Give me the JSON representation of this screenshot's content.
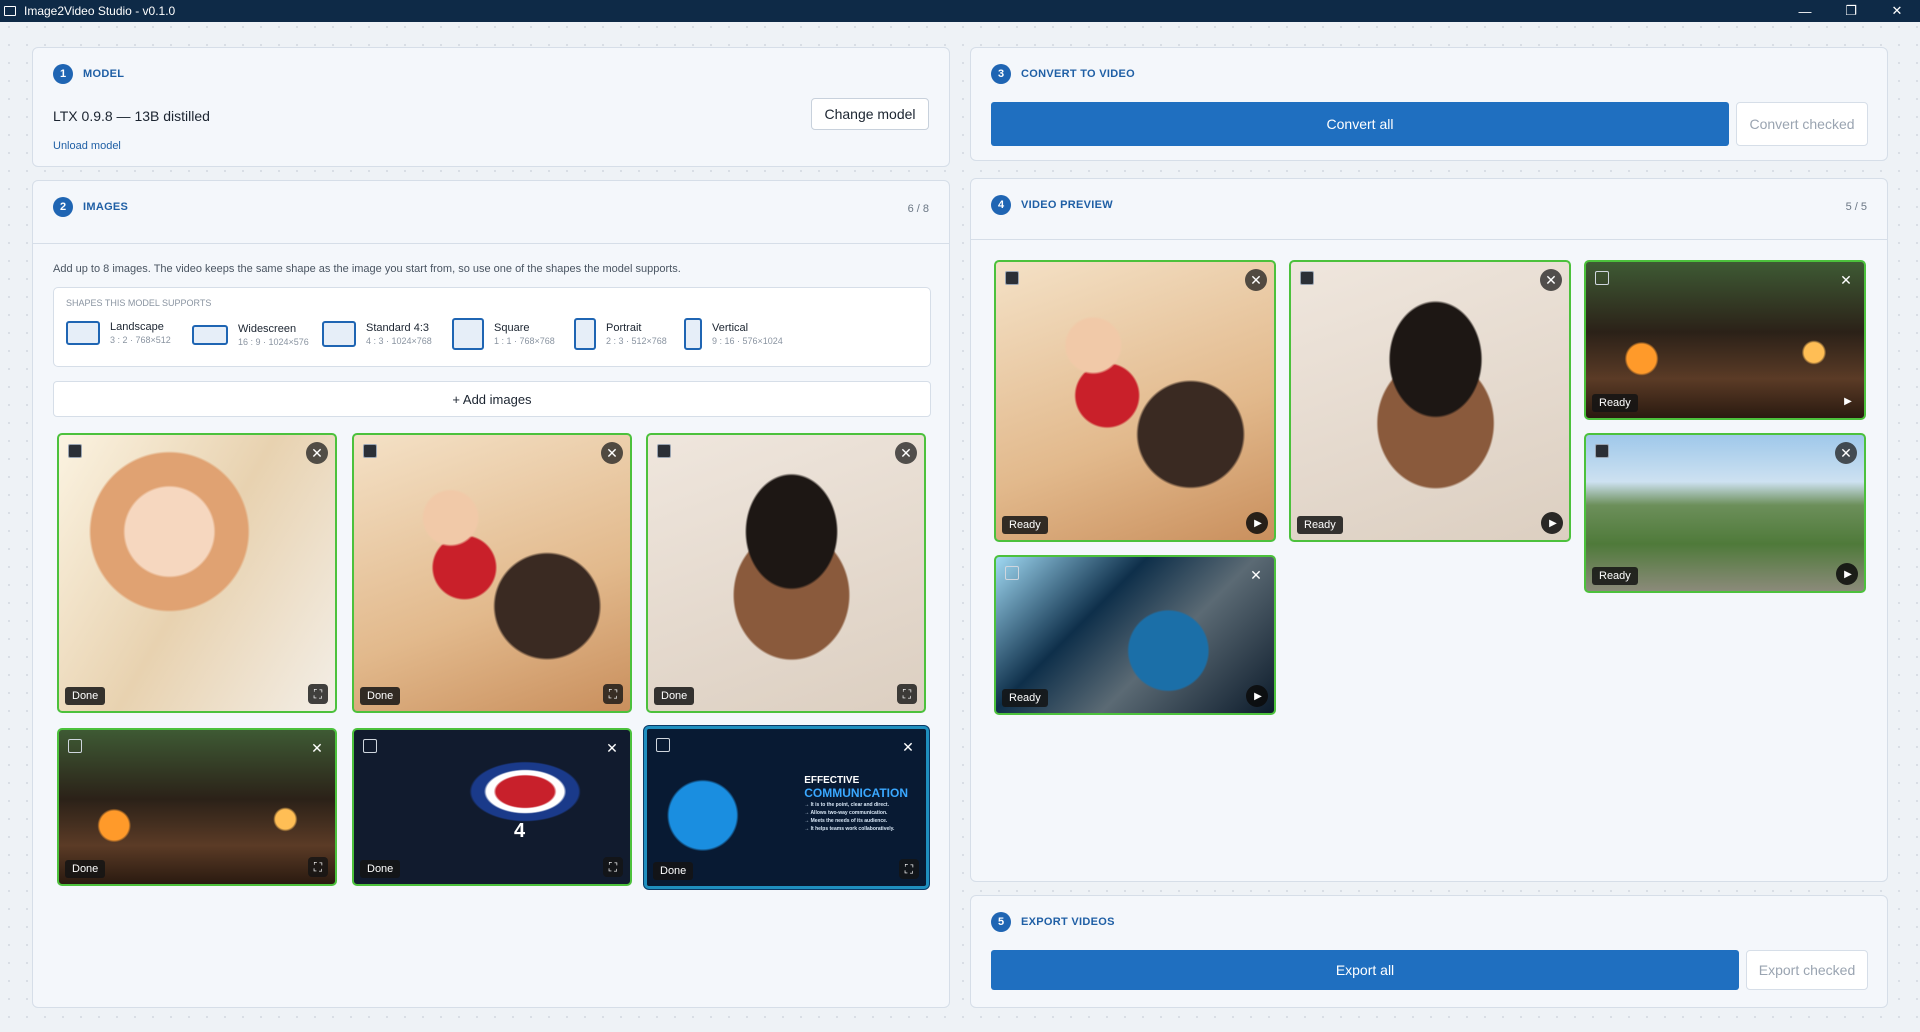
{
  "window": {
    "title": "Image2Video Studio - v0.1.0",
    "controls": [
      "—",
      "❐",
      "✕"
    ]
  },
  "model": {
    "step": "1",
    "title": "MODEL",
    "name": "LTX 0.9.8 — 13B distilled",
    "change_label": "Change model",
    "unload_label": "Unload model"
  },
  "images": {
    "step": "2",
    "title": "IMAGES",
    "count": "6 / 8",
    "description": "Add up to 8 images. The video keeps the same shape as the image you start from, so use one of the shapes the model supports.",
    "shapes_heading": "SHAPES THIS MODEL SUPPORTS",
    "shapes": [
      {
        "name": "Landscape",
        "spec": "3 : 2 · 768×512"
      },
      {
        "name": "Widescreen",
        "spec": "16 : 9 · 1024×576"
      },
      {
        "name": "Standard 4:3",
        "spec": "4 : 3 · 1024×768"
      },
      {
        "name": "Square",
        "spec": "1 : 1 · 768×768"
      },
      {
        "name": "Portrait",
        "spec": "2 : 3 · 512×768"
      },
      {
        "name": "Vertical",
        "spec": "9 : 16 · 576×1024"
      }
    ],
    "add_label": "+ Add images",
    "tiles": [
      {
        "status": "Done",
        "image": "laughing-woman"
      },
      {
        "status": "Done",
        "image": "father-and-baby"
      },
      {
        "status": "Done",
        "image": "smiling-man"
      },
      {
        "status": "Done",
        "image": "living-room-fireplace"
      },
      {
        "status": "Done",
        "image": "fourth-of-july-flag"
      },
      {
        "status": "Done",
        "image": "effective-communication"
      }
    ],
    "july_text": "4",
    "comm_title_1": "EFFECTIVE",
    "comm_title_2": "COMMUNICATION",
    "comm_lines": [
      "→ It is to the point, clear and direct.",
      "→ Allows two-way communication.",
      "→ Meets the needs of its audience.",
      "→ It helps teams work collaboratively."
    ]
  },
  "convert": {
    "step": "3",
    "title": "CONVERT TO VIDEO",
    "convert_all": "Convert all",
    "convert_checked": "Convert checked"
  },
  "preview": {
    "step": "4",
    "title": "VIDEO PREVIEW",
    "count": "5 / 5",
    "tiles": [
      {
        "status": "Ready",
        "image": "father-and-baby"
      },
      {
        "status": "Ready",
        "image": "smiling-man"
      },
      {
        "status": "Ready",
        "image": "living-room-fireplace"
      },
      {
        "status": "Ready",
        "image": "aerial-town"
      },
      {
        "status": "Ready",
        "image": "blue-crystal"
      }
    ]
  },
  "export": {
    "step": "5",
    "title": "EXPORT VIDEOS",
    "export_all": "Export all",
    "export_checked": "Export checked"
  },
  "icons": {
    "close": "✕",
    "expand": "⛶",
    "play": "▶"
  },
  "colors": {
    "accent": "#1f6fc0",
    "titlebar": "#0e2a47",
    "tile_border_done": "#4cc13c",
    "tile_border_selected": "#1f8fbf"
  }
}
